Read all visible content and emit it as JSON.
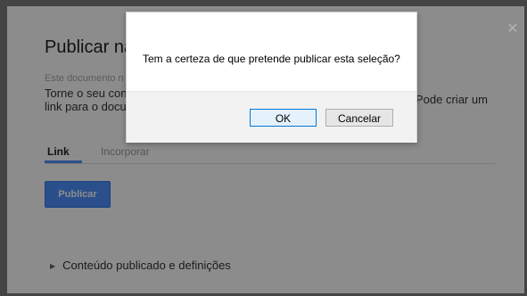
{
  "background_dialog": {
    "close_glyph": "×",
    "title": "Publicar na W",
    "subtle_text": "Este documento n",
    "description_left_line1": "Torne o seu cont",
    "description_left_line2": "link para o docu",
    "description_right": "Pode criar um",
    "tabs": [
      {
        "label": "Link"
      },
      {
        "label": "Incorporar"
      }
    ],
    "publish_button": "Publicar",
    "collapsible_label": "Conteúdo publicado e definições",
    "accent_color": "#4d90fe"
  },
  "confirm_dialog": {
    "message": "Tem a certeza de que pretende publicar esta seleção?",
    "ok_label": "OK",
    "cancel_label": "Cancelar"
  }
}
